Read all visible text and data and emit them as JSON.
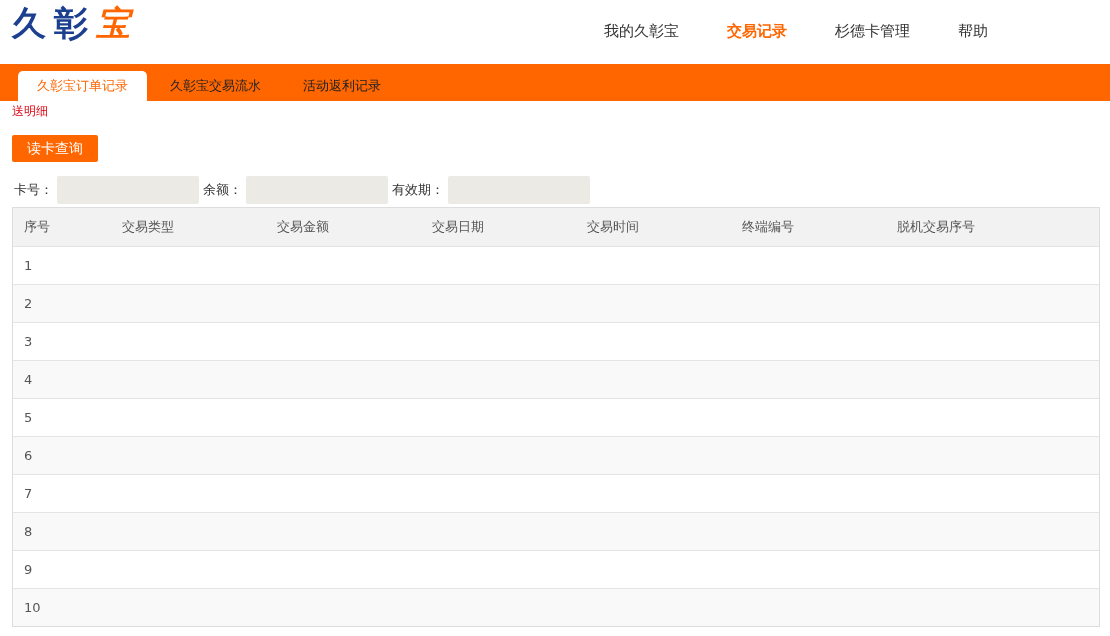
{
  "logo": {
    "text": "久彰",
    "accent": "宝"
  },
  "nav": [
    {
      "label": "我的久彰宝",
      "selected": false
    },
    {
      "label": "交易记录",
      "selected": true
    },
    {
      "label": "杉德卡管理",
      "selected": false
    },
    {
      "label": "帮助",
      "selected": false
    }
  ],
  "tabs": [
    {
      "label": "久彰宝订单记录",
      "selected": true
    },
    {
      "label": "久彰宝交易流水",
      "selected": false
    },
    {
      "label": "活动返利记录",
      "selected": false
    }
  ],
  "notice": "送明细",
  "read_button": "读卡查询",
  "fields": [
    {
      "label": "卡号："
    },
    {
      "label": "余额："
    },
    {
      "label": "有效期："
    }
  ],
  "table": {
    "columns": [
      "序号",
      "交易类型",
      "交易金额",
      "交易日期",
      "交易时间",
      "终端编号",
      "脱机交易序号"
    ],
    "rows": [
      [
        "1"
      ],
      [
        "2"
      ],
      [
        "3"
      ],
      [
        "4"
      ],
      [
        "5"
      ],
      [
        "6"
      ],
      [
        "7"
      ],
      [
        "8"
      ],
      [
        "9"
      ],
      [
        "10"
      ]
    ]
  }
}
